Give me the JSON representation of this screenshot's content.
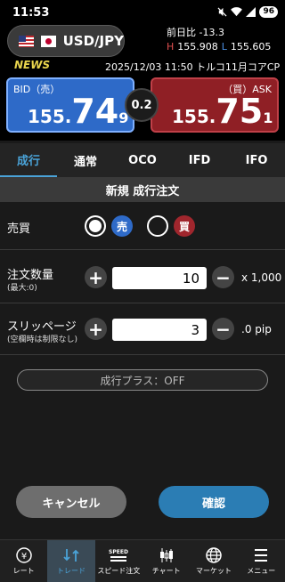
{
  "status_bar": {
    "time": "11:53",
    "battery": "96"
  },
  "header": {
    "pair": "USD/JPY",
    "change_label": "前日比 -13.3",
    "high_label": "H",
    "high_value": "155.908",
    "low_label": "L",
    "low_value": "155.605"
  },
  "news": {
    "label": "NEWS",
    "text": "2025/12/03 11:50 トルコ11月コアCP"
  },
  "bid": {
    "label": "BID（売）",
    "price_prefix": "155.",
    "price_main": "74",
    "price_frac": "9"
  },
  "ask": {
    "label": "（買）ASK",
    "price_prefix": "155.",
    "price_main": "75",
    "price_frac": "1"
  },
  "spread": "0.2",
  "tabs": [
    {
      "label": "成行",
      "active": true
    },
    {
      "label": "通常",
      "active": false
    },
    {
      "label": "OCO",
      "active": false
    },
    {
      "label": "IFD",
      "active": false
    },
    {
      "label": "IFO",
      "active": false
    }
  ],
  "section_title": "新規 成行注文",
  "side": {
    "label": "売買",
    "sell_label": "売",
    "buy_label": "買",
    "selected": "sell"
  },
  "quantity": {
    "label": "注文数量",
    "sub_label": "(最大:0)",
    "minus": "−",
    "plus": "+",
    "value": "10",
    "unit": "x 1,000"
  },
  "slippage": {
    "label": "スリッページ",
    "sub_label": "(空欄時は制限なし)",
    "minus": "−",
    "plus": "+",
    "value": "3",
    "unit": ".0 pip"
  },
  "plus_toggle": "成行プラス：OFF",
  "buttons": {
    "cancel": "キャンセル",
    "confirm": "確認"
  },
  "bottom_nav": [
    {
      "label": "レート",
      "icon": "rate-icon",
      "active": false
    },
    {
      "label": "トレード",
      "icon": "trade-icon",
      "active": true
    },
    {
      "label": "スピード注文",
      "icon": "speed-icon",
      "active": false
    },
    {
      "label": "チャート",
      "icon": "chart-icon",
      "active": false
    },
    {
      "label": "マーケット",
      "icon": "globe-icon",
      "active": false
    },
    {
      "label": "メニュー",
      "icon": "menu-icon",
      "active": false
    }
  ],
  "colors": {
    "accent": "#4aa3d8",
    "bid": "#2e6ac8",
    "ask": "#8f1f25",
    "confirm": "#2b7db4"
  }
}
